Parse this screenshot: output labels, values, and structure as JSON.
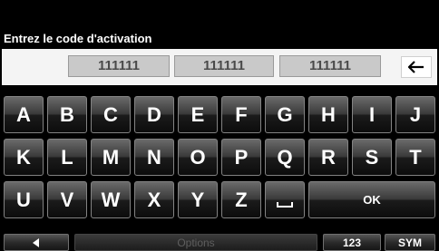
{
  "header": {
    "title": "Entrez le code d'activation"
  },
  "code_fields": [
    "111111",
    "111111",
    "111111"
  ],
  "icons": {
    "backspace": "arrow-left-icon",
    "back": "triangle-left-icon",
    "space": "space-bar-icon"
  },
  "keyboard": {
    "row1": [
      "A",
      "B",
      "C",
      "D",
      "E",
      "F",
      "G",
      "H",
      "I",
      "J"
    ],
    "row2": [
      "K",
      "L",
      "M",
      "N",
      "O",
      "P",
      "Q",
      "R",
      "S",
      "T"
    ],
    "row3": [
      "U",
      "V",
      "W",
      "X",
      "Y",
      "Z"
    ],
    "ok_label": "OK"
  },
  "bottom_bar": {
    "options_label": "Options",
    "numbers_label": "123",
    "symbols_label": "SYM"
  }
}
